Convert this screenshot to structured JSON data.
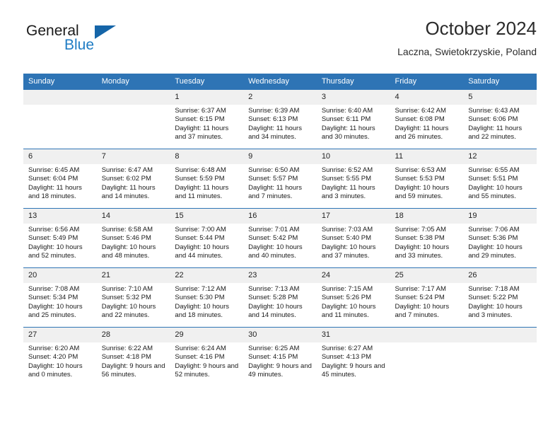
{
  "brand": {
    "word1": "General",
    "word2": "Blue",
    "logo_icon": "triangle-flag-icon",
    "accent_color": "#1f7cc4",
    "triangle_color": "#1565a8"
  },
  "header": {
    "title": "October 2024",
    "subtitle": "Laczna, Swietokrzyskie, Poland"
  },
  "theme": {
    "header_bg": "#2e74b5",
    "daynum_bg": "#f0f0f0",
    "row_border": "#2e74b5"
  },
  "calendar": {
    "weekday_headers": [
      "Sunday",
      "Monday",
      "Tuesday",
      "Wednesday",
      "Thursday",
      "Friday",
      "Saturday"
    ],
    "weeks": [
      [
        {
          "day": "",
          "blank": true
        },
        {
          "day": "",
          "blank": true
        },
        {
          "day": "1",
          "sunrise": "Sunrise: 6:37 AM",
          "sunset": "Sunset: 6:15 PM",
          "daylight": "Daylight: 11 hours and 37 minutes."
        },
        {
          "day": "2",
          "sunrise": "Sunrise: 6:39 AM",
          "sunset": "Sunset: 6:13 PM",
          "daylight": "Daylight: 11 hours and 34 minutes."
        },
        {
          "day": "3",
          "sunrise": "Sunrise: 6:40 AM",
          "sunset": "Sunset: 6:11 PM",
          "daylight": "Daylight: 11 hours and 30 minutes."
        },
        {
          "day": "4",
          "sunrise": "Sunrise: 6:42 AM",
          "sunset": "Sunset: 6:08 PM",
          "daylight": "Daylight: 11 hours and 26 minutes."
        },
        {
          "day": "5",
          "sunrise": "Sunrise: 6:43 AM",
          "sunset": "Sunset: 6:06 PM",
          "daylight": "Daylight: 11 hours and 22 minutes."
        }
      ],
      [
        {
          "day": "6",
          "sunrise": "Sunrise: 6:45 AM",
          "sunset": "Sunset: 6:04 PM",
          "daylight": "Daylight: 11 hours and 18 minutes."
        },
        {
          "day": "7",
          "sunrise": "Sunrise: 6:47 AM",
          "sunset": "Sunset: 6:02 PM",
          "daylight": "Daylight: 11 hours and 14 minutes."
        },
        {
          "day": "8",
          "sunrise": "Sunrise: 6:48 AM",
          "sunset": "Sunset: 5:59 PM",
          "daylight": "Daylight: 11 hours and 11 minutes."
        },
        {
          "day": "9",
          "sunrise": "Sunrise: 6:50 AM",
          "sunset": "Sunset: 5:57 PM",
          "daylight": "Daylight: 11 hours and 7 minutes."
        },
        {
          "day": "10",
          "sunrise": "Sunrise: 6:52 AM",
          "sunset": "Sunset: 5:55 PM",
          "daylight": "Daylight: 11 hours and 3 minutes."
        },
        {
          "day": "11",
          "sunrise": "Sunrise: 6:53 AM",
          "sunset": "Sunset: 5:53 PM",
          "daylight": "Daylight: 10 hours and 59 minutes."
        },
        {
          "day": "12",
          "sunrise": "Sunrise: 6:55 AM",
          "sunset": "Sunset: 5:51 PM",
          "daylight": "Daylight: 10 hours and 55 minutes."
        }
      ],
      [
        {
          "day": "13",
          "sunrise": "Sunrise: 6:56 AM",
          "sunset": "Sunset: 5:49 PM",
          "daylight": "Daylight: 10 hours and 52 minutes."
        },
        {
          "day": "14",
          "sunrise": "Sunrise: 6:58 AM",
          "sunset": "Sunset: 5:46 PM",
          "daylight": "Daylight: 10 hours and 48 minutes."
        },
        {
          "day": "15",
          "sunrise": "Sunrise: 7:00 AM",
          "sunset": "Sunset: 5:44 PM",
          "daylight": "Daylight: 10 hours and 44 minutes."
        },
        {
          "day": "16",
          "sunrise": "Sunrise: 7:01 AM",
          "sunset": "Sunset: 5:42 PM",
          "daylight": "Daylight: 10 hours and 40 minutes."
        },
        {
          "day": "17",
          "sunrise": "Sunrise: 7:03 AM",
          "sunset": "Sunset: 5:40 PM",
          "daylight": "Daylight: 10 hours and 37 minutes."
        },
        {
          "day": "18",
          "sunrise": "Sunrise: 7:05 AM",
          "sunset": "Sunset: 5:38 PM",
          "daylight": "Daylight: 10 hours and 33 minutes."
        },
        {
          "day": "19",
          "sunrise": "Sunrise: 7:06 AM",
          "sunset": "Sunset: 5:36 PM",
          "daylight": "Daylight: 10 hours and 29 minutes."
        }
      ],
      [
        {
          "day": "20",
          "sunrise": "Sunrise: 7:08 AM",
          "sunset": "Sunset: 5:34 PM",
          "daylight": "Daylight: 10 hours and 25 minutes."
        },
        {
          "day": "21",
          "sunrise": "Sunrise: 7:10 AM",
          "sunset": "Sunset: 5:32 PM",
          "daylight": "Daylight: 10 hours and 22 minutes."
        },
        {
          "day": "22",
          "sunrise": "Sunrise: 7:12 AM",
          "sunset": "Sunset: 5:30 PM",
          "daylight": "Daylight: 10 hours and 18 minutes."
        },
        {
          "day": "23",
          "sunrise": "Sunrise: 7:13 AM",
          "sunset": "Sunset: 5:28 PM",
          "daylight": "Daylight: 10 hours and 14 minutes."
        },
        {
          "day": "24",
          "sunrise": "Sunrise: 7:15 AM",
          "sunset": "Sunset: 5:26 PM",
          "daylight": "Daylight: 10 hours and 11 minutes."
        },
        {
          "day": "25",
          "sunrise": "Sunrise: 7:17 AM",
          "sunset": "Sunset: 5:24 PM",
          "daylight": "Daylight: 10 hours and 7 minutes."
        },
        {
          "day": "26",
          "sunrise": "Sunrise: 7:18 AM",
          "sunset": "Sunset: 5:22 PM",
          "daylight": "Daylight: 10 hours and 3 minutes."
        }
      ],
      [
        {
          "day": "27",
          "sunrise": "Sunrise: 6:20 AM",
          "sunset": "Sunset: 4:20 PM",
          "daylight": "Daylight: 10 hours and 0 minutes."
        },
        {
          "day": "28",
          "sunrise": "Sunrise: 6:22 AM",
          "sunset": "Sunset: 4:18 PM",
          "daylight": "Daylight: 9 hours and 56 minutes."
        },
        {
          "day": "29",
          "sunrise": "Sunrise: 6:24 AM",
          "sunset": "Sunset: 4:16 PM",
          "daylight": "Daylight: 9 hours and 52 minutes."
        },
        {
          "day": "30",
          "sunrise": "Sunrise: 6:25 AM",
          "sunset": "Sunset: 4:15 PM",
          "daylight": "Daylight: 9 hours and 49 minutes."
        },
        {
          "day": "31",
          "sunrise": "Sunrise: 6:27 AM",
          "sunset": "Sunset: 4:13 PM",
          "daylight": "Daylight: 9 hours and 45 minutes."
        },
        {
          "day": "",
          "blank": true
        },
        {
          "day": "",
          "blank": true
        }
      ]
    ]
  }
}
